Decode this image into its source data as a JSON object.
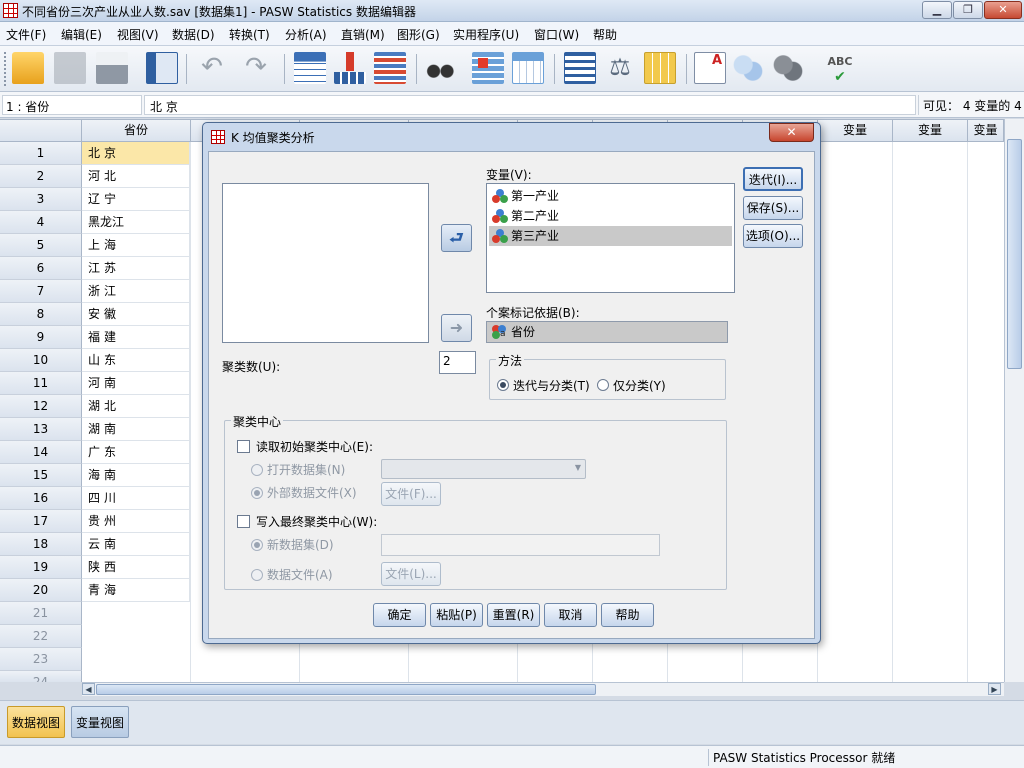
{
  "window": {
    "title": "不同省份三次产业从业人数.sav [数据集1] - PASW Statistics 数据编辑器",
    "minimize_icon": "minimize-icon",
    "maximize_icon": "restore-icon",
    "close_label": "✕"
  },
  "menu": [
    {
      "label": "文件(F)"
    },
    {
      "label": "编辑(E)"
    },
    {
      "label": "视图(V)"
    },
    {
      "label": "数据(D)"
    },
    {
      "label": "转换(T)"
    },
    {
      "label": "分析(A)"
    },
    {
      "label": "直销(M)"
    },
    {
      "label": "图形(G)"
    },
    {
      "label": "实用程序(U)"
    },
    {
      "label": "窗口(W)"
    },
    {
      "label": "帮助"
    }
  ],
  "toolbar_icons": [
    "open-folder-icon",
    "save-icon",
    "print-icon",
    "dialog-recall-icon",
    "undo-icon",
    "redo-icon",
    "goto-case-icon",
    "goto-variable-icon",
    "variables-icon",
    "find-icon",
    "insert-cases-icon",
    "insert-variable-icon",
    "split-file-icon",
    "weight-cases-icon",
    "select-cases-icon",
    "value-labels-icon",
    "use-sets-icon",
    "show-all-variables-icon",
    "spell-check-icon"
  ],
  "cellbar": {
    "ref": "1 : 省份",
    "value": "北 京",
    "visible": "可见： 4 变量的 4"
  },
  "grid": {
    "column_header": "省份",
    "empty_col_header": "变量",
    "rows": [
      {
        "num": "1",
        "value": "北京"
      },
      {
        "num": "2",
        "value": "河北"
      },
      {
        "num": "3",
        "value": "辽宁"
      },
      {
        "num": "4",
        "value": "黑龙江"
      },
      {
        "num": "5",
        "value": "上海"
      },
      {
        "num": "6",
        "value": "江苏"
      },
      {
        "num": "7",
        "value": "浙江"
      },
      {
        "num": "8",
        "value": "安徽"
      },
      {
        "num": "9",
        "value": "福建"
      },
      {
        "num": "10",
        "value": "山东"
      },
      {
        "num": "11",
        "value": "河南"
      },
      {
        "num": "12",
        "value": "湖北"
      },
      {
        "num": "13",
        "value": "湖南"
      },
      {
        "num": "14",
        "value": "广东"
      },
      {
        "num": "15",
        "value": "海南"
      },
      {
        "num": "16",
        "value": "四川"
      },
      {
        "num": "17",
        "value": "贵州"
      },
      {
        "num": "18",
        "value": "云南"
      },
      {
        "num": "19",
        "value": "陕西"
      },
      {
        "num": "20",
        "value": "青海"
      }
    ],
    "empty_rows": [
      "21",
      "22",
      "23",
      "24"
    ]
  },
  "view_tabs": {
    "data_view": "数据视图",
    "variable_view": "变量视图"
  },
  "status": {
    "text": "PASW Statistics Processor 就绪"
  },
  "dialog": {
    "title": "K 均值聚类分析",
    "close_label": "✕",
    "variables_label": "变量(V):",
    "variables": [
      "第一产业",
      "第二产业",
      "第三产业"
    ],
    "case_label_label": "个案标记依据(B):",
    "case_label_value": "省份",
    "clusters_label": "聚类数(U):",
    "clusters_value": "2",
    "method": {
      "title": "方法",
      "option1": "迭代与分类(T)",
      "option2": "仅分类(Y)"
    },
    "centers": {
      "title": "聚类中心",
      "read_initial": "读取初始聚类中心(E):",
      "open_dataset": "打开数据集(N)",
      "external_file": "外部数据文件(X)",
      "file_button1": "文件(F)...",
      "write_final": "写入最终聚类中心(W):",
      "new_dataset": "新数据集(D)",
      "data_file": "数据文件(A)",
      "file_button2": "文件(L)..."
    },
    "side_buttons": {
      "iterate": "迭代(I)...",
      "save": "保存(S)...",
      "options": "选项(O)..."
    },
    "bottom_buttons": {
      "ok": "确定",
      "paste": "粘贴(P)",
      "reset": "重置(R)",
      "cancel": "取消",
      "help": "帮助"
    }
  },
  "colors": {
    "selected_cell": "#fbe7a8",
    "selected_item": "#c9c9c9",
    "accent": "#3d6fb3"
  }
}
